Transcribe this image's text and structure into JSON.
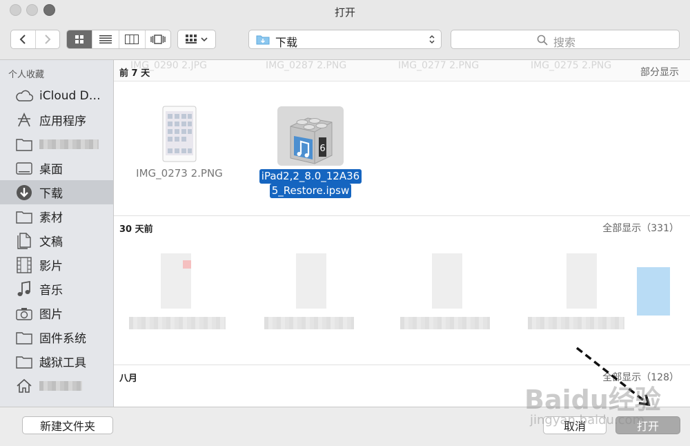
{
  "window": {
    "title": "打开"
  },
  "toolbar": {
    "location": "下载",
    "search_placeholder": "搜索"
  },
  "sidebar": {
    "header": "个人收藏",
    "items": [
      {
        "label": "iCloud D…",
        "icon": "cloud-icon"
      },
      {
        "label": "应用程序",
        "icon": "applications-icon"
      },
      {
        "label": "",
        "icon": "folder-icon",
        "obscured": true
      },
      {
        "label": "桌面",
        "icon": "desktop-icon"
      },
      {
        "label": "下载",
        "icon": "download-icon",
        "selected": true
      },
      {
        "label": "素材",
        "icon": "folder-icon"
      },
      {
        "label": "文稿",
        "icon": "documents-icon"
      },
      {
        "label": "影片",
        "icon": "movies-icon"
      },
      {
        "label": "音乐",
        "icon": "music-icon"
      },
      {
        "label": "图片",
        "icon": "camera-icon"
      },
      {
        "label": "固件系统",
        "icon": "folder-icon"
      },
      {
        "label": "越狱工具",
        "icon": "folder-icon"
      },
      {
        "label": "",
        "icon": "home-icon",
        "obscured": true
      }
    ]
  },
  "sections": [
    {
      "title": "前 7 天",
      "link": "部分显示",
      "ghost_names": [
        "IMG_0290 2.JPG",
        "IMG_0287 2.PNG",
        "IMG_0277 2.PNG",
        "IMG_0275 2.PNG"
      ],
      "files": [
        {
          "name": "IMG_0273 2.PNG"
        },
        {
          "name_line1": "iPad2,2_8.0_12A36",
          "name_line2": "5_Restore.ipsw",
          "selected": true
        }
      ]
    },
    {
      "title": "30 天前",
      "link": "全部显示（331）"
    },
    {
      "title": "八月",
      "link": "全部显示（128）"
    }
  ],
  "buttons": {
    "new_folder": "新建文件夹",
    "cancel": "取消",
    "open": "打开"
  },
  "watermark": {
    "brand": "Baidu经验",
    "url": "jingyan.baidu.com"
  },
  "colors": {
    "selection": "#1565c0",
    "sidebar_selected": "#c9ccd1"
  }
}
